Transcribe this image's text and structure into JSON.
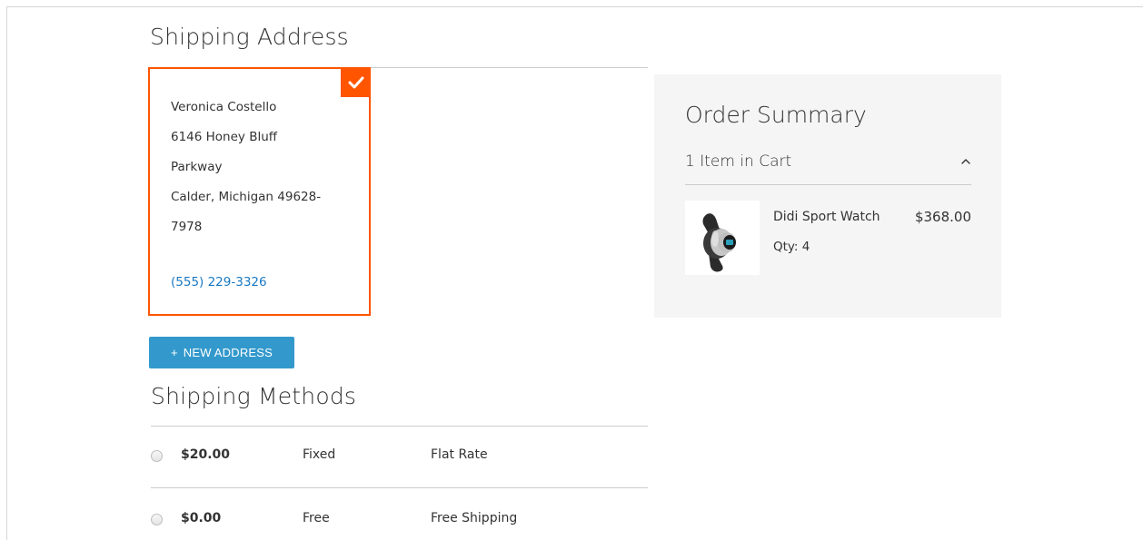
{
  "shipping_address": {
    "title": "Shipping Address",
    "selected_address": {
      "lines": [
        "Veronica Costello",
        "6146 Honey Bluff",
        "Parkway",
        "Calder, Michigan 49628-",
        "7978"
      ],
      "phone": "(555) 229-3326"
    },
    "new_address_button": {
      "icon": "+",
      "label": "NEW ADDRESS"
    }
  },
  "shipping_methods": {
    "title": "Shipping Methods",
    "rows": [
      {
        "price": "$20.00",
        "method": "Fixed",
        "carrier": "Flat Rate",
        "selected": false
      },
      {
        "price": "$0.00",
        "method": "Free",
        "carrier": "Free Shipping",
        "selected": false
      }
    ]
  },
  "order_summary": {
    "title": "Order Summary",
    "items_in_cart": "1 Item in Cart",
    "expanded": true,
    "items": [
      {
        "name": "Didi Sport Watch",
        "qty": "Qty: 4",
        "price": "$368.00",
        "image_icon": "sport-watch-icon"
      }
    ]
  },
  "colors": {
    "accent": "#ff5501",
    "button": "#3399cc",
    "link": "#1979c3",
    "summary_bg": "#f5f5f5"
  }
}
